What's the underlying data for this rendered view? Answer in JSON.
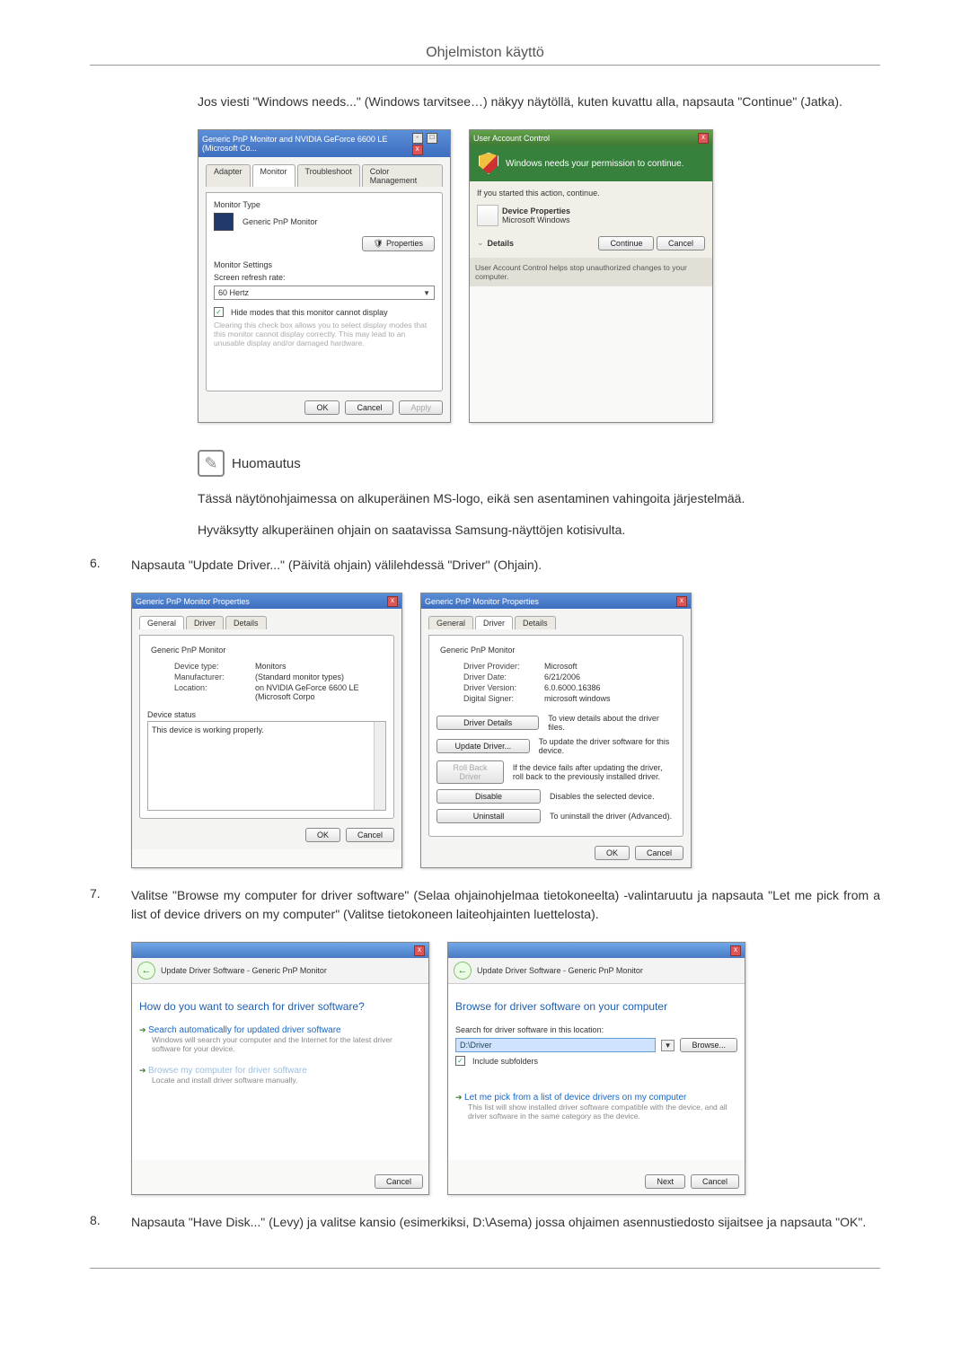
{
  "header": {
    "title": "Ohjelmiston käyttö"
  },
  "intro": {
    "para1": "Jos viesti \"Windows needs...\" (Windows tarvitsee…) näkyy näytöllä, kuten kuvattu alla, napsauta \"Continue\" (Jatka)."
  },
  "monA": {
    "title": "Generic PnP Monitor and NVIDIA GeForce 6600 LE (Microsoft Co...",
    "tabs": [
      "Adapter",
      "Monitor",
      "Troubleshoot",
      "Color Management"
    ],
    "section_monitor_type": "Monitor Type",
    "monitor_name": "Generic PnP Monitor",
    "properties_btn": "Properties",
    "section_monitor_settings": "Monitor Settings",
    "refresh_label": "Screen refresh rate:",
    "refresh_value": "60 Hertz",
    "hide_modes_label": "Hide modes that this monitor cannot display",
    "hide_modes_desc": "Clearing this check box allows you to select display modes that this monitor cannot display correctly. This may lead to an unusable display and/or damaged hardware.",
    "ok": "OK",
    "cancel": "Cancel",
    "apply": "Apply"
  },
  "uac": {
    "title": "User Account Control",
    "banner": "Windows needs your permission to continue.",
    "if_started": "If you started this action, continue.",
    "app_name": "Device Properties",
    "publisher": "Microsoft Windows",
    "details": "Details",
    "continue": "Continue",
    "cancel": "Cancel",
    "footer": "User Account Control helps stop unauthorized changes to your computer."
  },
  "note": {
    "label": "Huomautus",
    "p1": "Tässä näytönohjaimessa on alkuperäinen MS-logo, eikä sen asentaminen vahingoita järjestelmää.",
    "p2": "Hyväksytty alkuperäinen ohjain on saatavissa Samsung-näyttöjen kotisivulta."
  },
  "step6": {
    "num": "6.",
    "text": "Napsauta \"Update Driver...\" (Päivitä ohjain) välilehdessä \"Driver\" (Ohjain)."
  },
  "propGeneral": {
    "title": "Generic PnP Monitor Properties",
    "tabs": [
      "General",
      "Driver",
      "Details"
    ],
    "name": "Generic PnP Monitor",
    "device_type_k": "Device type:",
    "device_type_v": "Monitors",
    "manufacturer_k": "Manufacturer:",
    "manufacturer_v": "(Standard monitor types)",
    "location_k": "Location:",
    "location_v": "on NVIDIA GeForce 6600 LE (Microsoft Corpo",
    "status_label": "Device status",
    "status_text": "This device is working properly.",
    "ok": "OK",
    "cancel": "Cancel"
  },
  "propDriver": {
    "title": "Generic PnP Monitor Properties",
    "tabs": [
      "General",
      "Driver",
      "Details"
    ],
    "name": "Generic PnP Monitor",
    "provider_k": "Driver Provider:",
    "provider_v": "Microsoft",
    "date_k": "Driver Date:",
    "date_v": "6/21/2006",
    "version_k": "Driver Version:",
    "version_v": "6.0.6000.16386",
    "signer_k": "Digital Signer:",
    "signer_v": "microsoft windows",
    "btn_details": "Driver Details",
    "desc_details": "To view details about the driver files.",
    "btn_update": "Update Driver...",
    "desc_update": "To update the driver software for this device.",
    "btn_rollback": "Roll Back Driver",
    "desc_rollback": "If the device fails after updating the driver, roll back to the previously installed driver.",
    "btn_disable": "Disable",
    "desc_disable": "Disables the selected device.",
    "btn_uninstall": "Uninstall",
    "desc_uninstall": "To uninstall the driver (Advanced).",
    "ok": "OK",
    "cancel": "Cancel"
  },
  "step7": {
    "num": "7.",
    "text": "Valitse \"Browse my computer for driver software\" (Selaa ohjainohjelmaa tietokoneelta) -valintaruutu ja napsauta \"Let me pick from a list of device drivers on my computer\" (Valitse tietokoneen laiteohjainten luettelosta)."
  },
  "wizA": {
    "crumb": "Update Driver Software - Generic PnP Monitor",
    "heading": "How do you want to search for driver software?",
    "opt1_title": "Search automatically for updated driver software",
    "opt1_desc": "Windows will search your computer and the Internet for the latest driver software for your device.",
    "opt2_title": "Browse my computer for driver software",
    "opt2_desc": "Locate and install driver software manually.",
    "cancel": "Cancel"
  },
  "wizB": {
    "crumb": "Update Driver Software - Generic PnP Monitor",
    "heading": "Browse for driver software on your computer",
    "search_label": "Search for driver software in this location:",
    "path_value": "D:\\Driver",
    "browse": "Browse...",
    "include_sub": "Include subfolders",
    "opt_title": "Let me pick from a list of device drivers on my computer",
    "opt_desc": "This list will show installed driver software compatible with the device, and all driver software in the same category as the device.",
    "next": "Next",
    "cancel": "Cancel"
  },
  "step8": {
    "num": "8.",
    "text": "Napsauta \"Have Disk...\" (Levy) ja valitse kansio (esimerkiksi, D:\\Asema) jossa ohjaimen asennustiedosto sijaitsee ja napsauta \"OK\"."
  }
}
